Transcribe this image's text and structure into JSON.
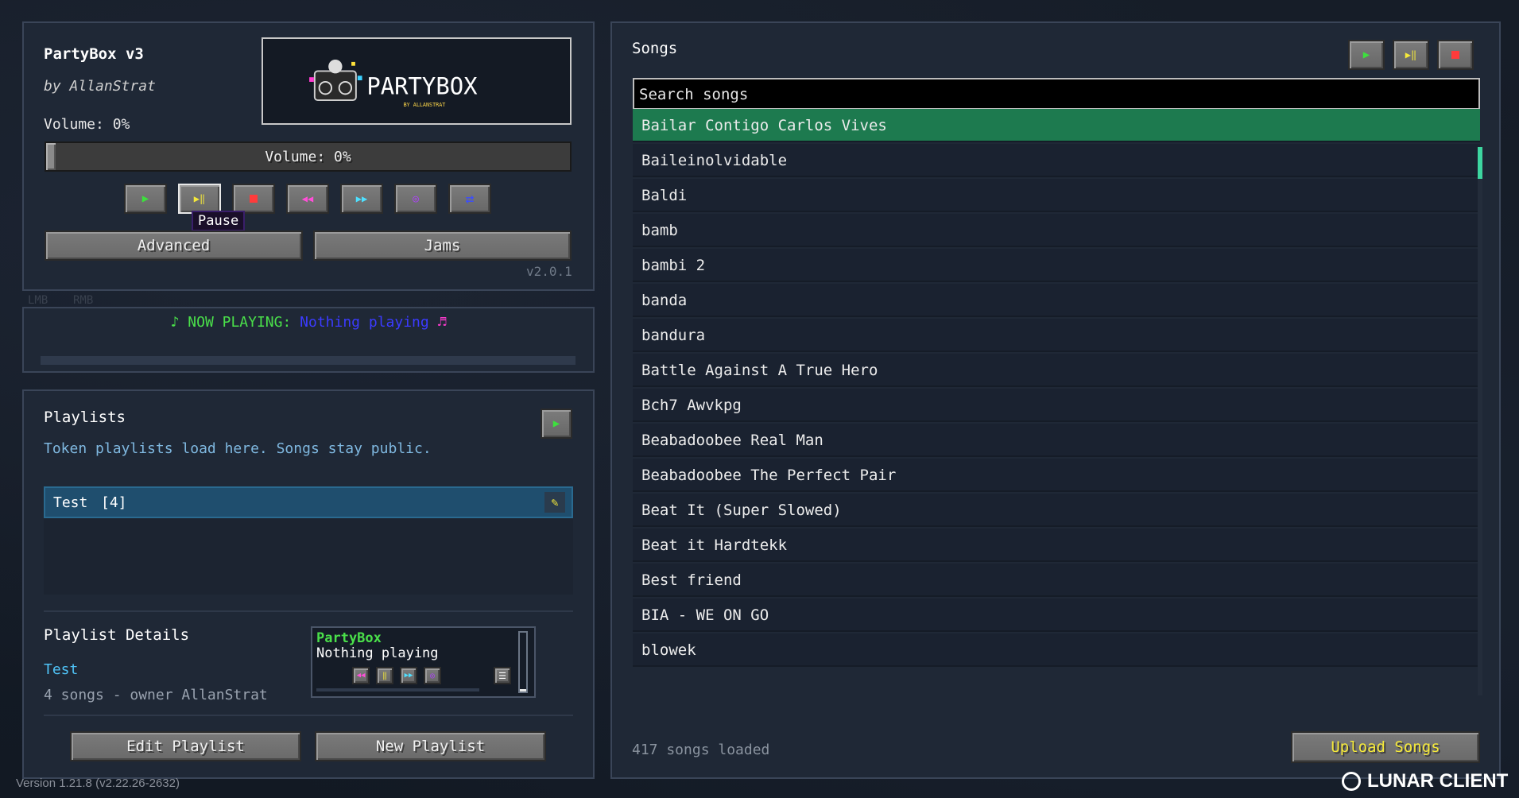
{
  "app": {
    "title": "PartyBox v3",
    "author": "by AllanStrat",
    "version": "v2.0.1",
    "logo_text": "PARTYBOX",
    "logo_sub": "BY ALLANSTRAT"
  },
  "volume": {
    "label": "Volume: 0%",
    "slider_label": "Volume: 0%",
    "value_percent": 0
  },
  "controls": {
    "play_icon": "play-icon",
    "pause_icon": "pause-icon",
    "stop_icon": "stop-icon",
    "prev_icon": "previous-icon",
    "next_icon": "next-icon",
    "shuffle_icon": "shuffle-icon",
    "repeat_icon": "repeat-icon",
    "tooltip": "Pause"
  },
  "buttons": {
    "advanced": "Advanced",
    "jams": "Jams",
    "edit_playlist": "Edit Playlist",
    "new_playlist": "New Playlist",
    "upload_songs": "Upload Songs"
  },
  "mouse_hint": {
    "lmb": "LMB",
    "rmb": "RMB"
  },
  "now_playing": {
    "prefix": "♪ NOW PLAYING:",
    "value": "Nothing playing",
    "suffix": "♬"
  },
  "playlists": {
    "title": "Playlists",
    "subtitle": "Token playlists load here. Songs stay public.",
    "items": [
      {
        "name": "Test",
        "count": "[4]"
      }
    ],
    "details_title": "Playlist Details",
    "details_name": "Test",
    "details_meta": "4 songs - owner AllanStrat"
  },
  "mini_player": {
    "title": "PartyBox",
    "status": "Nothing playing"
  },
  "songs": {
    "title": "Songs",
    "search_placeholder": "Search songs",
    "loaded": "417 songs loaded",
    "items": [
      "Bailar Contigo Carlos Vives",
      "Baileinolvidable",
      "Baldi",
      "bamb",
      "bambi 2",
      "banda",
      "bandura",
      "Battle Against A True Hero",
      "Bch7 Awvkpg",
      "Beabadoobee Real Man",
      "Beabadoobee The Perfect Pair",
      "Beat It (Super Slowed)",
      "Beat it Hardtekk",
      "Best friend",
      "BIA - WE ON GO",
      "blowek"
    ],
    "selected_index": 0
  },
  "footer": {
    "version": "Version 1.21.8 (v2.22.26-2632)",
    "client": "LUNAR CLIENT"
  },
  "colors": {
    "accent_green": "#1d7a4f",
    "now_playing_green": "#4ae04a",
    "now_playing_value": "#3b3bff",
    "link_blue": "#4fc3f7",
    "upload_yellow": "#f5e93a"
  }
}
